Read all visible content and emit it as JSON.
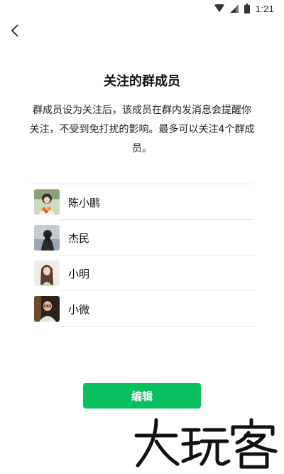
{
  "status_bar": {
    "time": "1:21",
    "icons": [
      "wifi-icon",
      "signal-icon",
      "battery-icon"
    ]
  },
  "header": {
    "back_icon": "chevron-left-icon"
  },
  "main": {
    "title": "关注的群成员",
    "description": "群成员设为关注后，该成员在群内发消息会提醒你关注，不受到免打扰的影响。最多可以关注4个群成员。"
  },
  "members": [
    {
      "name": "陈小鹏",
      "avatar": "avatar-1"
    },
    {
      "name": "杰民",
      "avatar": "avatar-2"
    },
    {
      "name": "小明",
      "avatar": "avatar-3"
    },
    {
      "name": "小微",
      "avatar": "avatar-4"
    }
  ],
  "footer": {
    "edit_label": "编辑"
  },
  "watermark": {
    "text": "大玩客"
  },
  "colors": {
    "accent": "#07c160",
    "divider": "#e8e8e8",
    "text": "#111111"
  }
}
